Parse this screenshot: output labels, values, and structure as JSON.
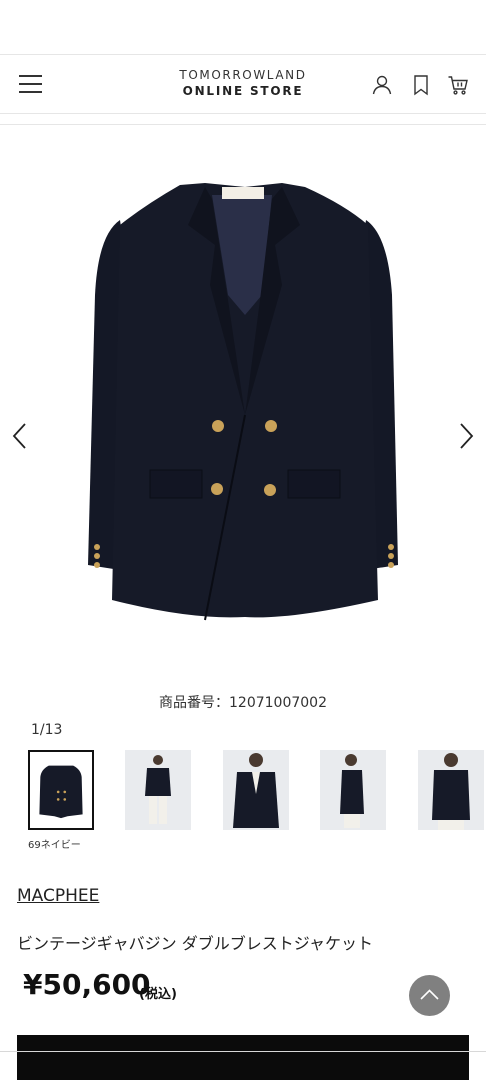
{
  "header": {
    "logo_line1": "TOMORROWLAND",
    "logo_line2": "ONLINE STORE",
    "icons": [
      "menu-icon",
      "user-icon",
      "bookmark-icon",
      "cart-icon"
    ]
  },
  "gallery": {
    "main_image": "navy double-breasted blazer with gold buttons",
    "prev_icon": "chevron-left-icon",
    "next_icon": "chevron-right-icon"
  },
  "product": {
    "code_text": "商品番号：12071007002",
    "pager": "1/13",
    "color_label": "69ネイビー",
    "brand": "MACPHEE",
    "name": "ビンテージギャバジン ダブルブレストジャケット",
    "price": "¥50,600",
    "tax_note": "(税込)"
  },
  "thumbnails": [
    {
      "desc": "jacket flat lay",
      "active": true
    },
    {
      "desc": "model full body with white pants",
      "active": false
    },
    {
      "desc": "model front upper body",
      "active": false
    },
    {
      "desc": "model side view",
      "active": false
    },
    {
      "desc": "model back view",
      "active": false
    }
  ],
  "colors": {
    "accent": "#0b0b0b",
    "jacket": "#161a28",
    "button_gold": "#c9a259",
    "scroll_top_bg": "#808080"
  }
}
